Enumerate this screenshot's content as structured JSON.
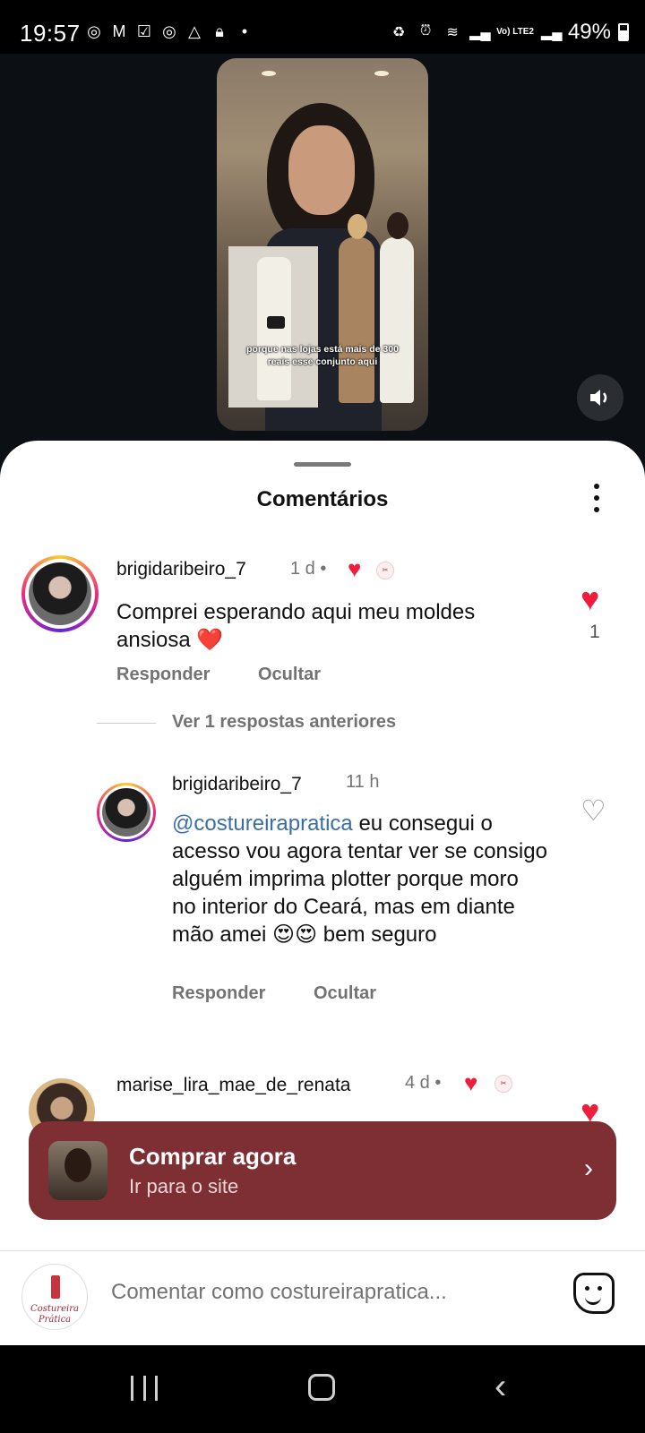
{
  "status_bar": {
    "time": "19:57",
    "battery": "49%",
    "network_label": "Vo) LTE2"
  },
  "video": {
    "caption": "porque nas lojas está mais de 300 reais esse conjunto aqui"
  },
  "sheet": {
    "title": "Comentários"
  },
  "comments": [
    {
      "username": "brigidaribeiro_7",
      "time": "1 d",
      "text": "Comprei esperando aqui meu moldes ansiosa ❤️",
      "like_count": "1",
      "actions": [
        "Responder",
        "Ocultar"
      ]
    },
    {
      "username": "marise_lira_mae_de_renata",
      "time": "4 d"
    }
  ],
  "replies_toggle": "Ver 1 respostas anteriores",
  "reply": {
    "username": "brigidaribeiro_7",
    "time": "11 h",
    "mention": "@costureirapratica",
    "text": " eu consegui o acesso vou agora tentar ver se consigo alguém imprima plotter porque moro no interior do Ceará, mas em diante mão amei 😍😍 bem seguro",
    "actions": [
      "Responder",
      "Ocultar"
    ]
  },
  "shop_banner": {
    "title": "Comprar agora",
    "subtitle": "Ir para o site"
  },
  "composer": {
    "placeholder": "Comentar como costureirapratica...",
    "avatar_line1": "Costureira",
    "avatar_line2": "Prática"
  },
  "icons": {
    "like": "heart-icon",
    "sound": "speaker-icon",
    "more": "more-vertical-icon",
    "sticker": "sticker-icon"
  },
  "colors": {
    "like_red": "#ee1d3c",
    "shop_bg": "#7d2f34",
    "mention": "#3a6ea5"
  }
}
